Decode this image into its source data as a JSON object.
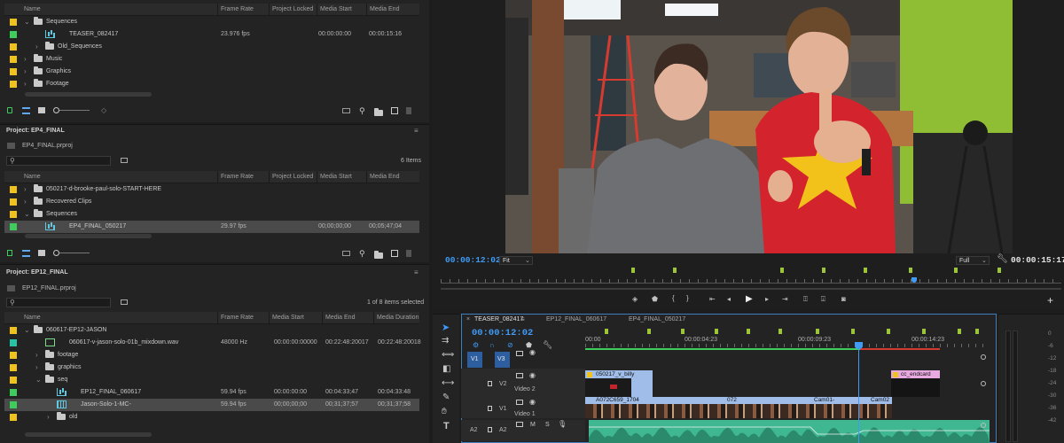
{
  "top_project": {
    "columns": [
      "Name",
      "Frame Rate",
      "Project Locked",
      "Media Start",
      "Media End"
    ],
    "rows": [
      {
        "name": "Sequences",
        "type": "folder",
        "expanded": true,
        "indent": 0,
        "color": "#f0c21e",
        "frame_rate": "",
        "locked": "",
        "media_start": "",
        "media_end": ""
      },
      {
        "name": "TEASER_082417",
        "type": "sequence",
        "indent": 2,
        "color": "#3ecc5d",
        "frame_rate": "23.976 fps",
        "locked": "",
        "media_start": "00:00:00:00",
        "media_end": "00:00:15:16"
      },
      {
        "name": "Old_Sequences",
        "type": "folder",
        "expanded": false,
        "indent": 1,
        "color": "#f0c21e",
        "frame_rate": "",
        "locked": "",
        "media_start": "",
        "media_end": ""
      },
      {
        "name": "Music",
        "type": "folder",
        "expanded": false,
        "indent": 0,
        "color": "#f0c21e",
        "frame_rate": "",
        "locked": "",
        "media_start": "",
        "media_end": ""
      },
      {
        "name": "Graphics",
        "type": "folder",
        "expanded": false,
        "indent": 0,
        "color": "#f0c21e",
        "frame_rate": "",
        "locked": "",
        "media_start": "",
        "media_end": ""
      },
      {
        "name": "Footage",
        "type": "folder",
        "expanded": false,
        "indent": 0,
        "color": "#f0c21e",
        "frame_rate": "",
        "locked": "",
        "media_start": "",
        "media_end": ""
      }
    ]
  },
  "ep4": {
    "title": "Project: EP4_FINAL",
    "file": "EP4_FINAL.prproj",
    "items_count": "6 Items",
    "columns": [
      "Name",
      "Frame Rate",
      "Project Locked",
      "Media Start",
      "Media End"
    ],
    "rows": [
      {
        "name": "050217-d-brooke-paul-solo-START-HERE",
        "type": "folder",
        "expanded": false,
        "indent": 0,
        "color": "#f0c21e",
        "frame_rate": "",
        "locked": "",
        "media_start": "",
        "media_end": ""
      },
      {
        "name": "Recovered Clips",
        "type": "folder",
        "expanded": false,
        "indent": 0,
        "color": "#f0c21e",
        "frame_rate": "",
        "locked": "",
        "media_start": "",
        "media_end": ""
      },
      {
        "name": "Sequences",
        "type": "folder",
        "expanded": true,
        "indent": 0,
        "color": "#f0c21e",
        "frame_rate": "",
        "locked": "",
        "media_start": "",
        "media_end": ""
      },
      {
        "name": "EP4_FINAL_050217",
        "type": "sequence",
        "indent": 2,
        "color": "#3ecc5d",
        "selected": true,
        "frame_rate": "29.97 fps",
        "locked": "",
        "media_start": "00;00;00;00",
        "media_end": "00;05;47;04"
      }
    ]
  },
  "ep12": {
    "title": "Project: EP12_FINAL",
    "file": "EP12_FINAL.prproj",
    "items_count": "1 of 8 items selected",
    "columns": [
      "Name",
      "Frame Rate",
      "Media Start",
      "Media End",
      "Media Duration"
    ],
    "rows": [
      {
        "name": "060617-EP12-JASON",
        "type": "folder",
        "expanded": true,
        "indent": 0,
        "color": "#f0c21e",
        "frame_rate": "",
        "media_start": "",
        "media_end": "",
        "media_duration": ""
      },
      {
        "name": "060617-v-jason-solo-01b_mixdown.wav",
        "type": "audio",
        "indent": 2,
        "color": "#26c4a4",
        "frame_rate": "48000 Hz",
        "media_start": "00:00:00:00000",
        "media_end": "00:22:48:20017",
        "media_duration": "00:22:48:20018"
      },
      {
        "name": "footage",
        "type": "folder",
        "expanded": false,
        "indent": 1,
        "color": "#f0c21e",
        "frame_rate": "",
        "media_start": "",
        "media_end": "",
        "media_duration": ""
      },
      {
        "name": "graphics",
        "type": "folder",
        "expanded": false,
        "indent": 1,
        "color": "#f0c21e",
        "frame_rate": "",
        "media_start": "",
        "media_end": "",
        "media_duration": ""
      },
      {
        "name": "seq",
        "type": "folder",
        "expanded": true,
        "indent": 1,
        "color": "#f0c21e",
        "frame_rate": "",
        "media_start": "",
        "media_end": "",
        "media_duration": ""
      },
      {
        "name": "EP12_FINAL_060617",
        "type": "sequence",
        "indent": 3,
        "color": "#3ecc5d",
        "frame_rate": "59.94 fps",
        "media_start": "00:00:00:00",
        "media_end": "00:04:33;47",
        "media_duration": "00:04:33:48"
      },
      {
        "name": "Jason-Solo-1-MC-",
        "type": "multicam",
        "indent": 3,
        "color": "#3ecc5d",
        "selected": true,
        "frame_rate": "59.94 fps",
        "media_start": "00;00;00;00",
        "media_end": "00;31;37;57",
        "media_duration": "00;31;37;58"
      },
      {
        "name": "old",
        "type": "folder",
        "expanded": false,
        "indent": 2,
        "color": "#f0c21e",
        "frame_rate": "",
        "media_start": "",
        "media_end": "",
        "media_duration": ""
      }
    ]
  },
  "program": {
    "current_tc": "00:00:12:02",
    "fit": "Fit",
    "full": "Full",
    "duration_tc": "00:00:15:17",
    "playhead_fraction": 0.7
  },
  "timeline": {
    "tabs": [
      "TEASER_082417",
      "EP12_FINAL_060617",
      "EP4_FINAL_050217"
    ],
    "tc": "00:00:12:02",
    "ruler": [
      "00:00",
      "00:00:04:23",
      "00:00:09:23",
      "00:00:14:23"
    ],
    "tracks": {
      "v1_src": "V1",
      "v3": "V3",
      "v2": "V2",
      "v2_name": "Video 2",
      "v1": "V1",
      "v1_name": "Video 1",
      "a2_src": "A2",
      "a2": "A2",
      "m": "M",
      "s": "S"
    },
    "clips": {
      "v2_a": "050217_v_billy",
      "v2_b": "cc_endcard",
      "v1_a": "A072C659_1704",
      "v1_b": "072",
      "v1_c": "Cam01-",
      "v1_d": "Cam02"
    }
  },
  "meter": {
    "scale": [
      "0",
      "-6",
      "-12",
      "-18",
      "-24",
      "-30",
      "-36",
      "-42"
    ]
  },
  "colors": {
    "accent_blue": "#3f9bf6",
    "folder": "#f0c21e",
    "sequence": "#3ecc5d",
    "audio": "#26c4a4",
    "marker": "#9dc53a"
  }
}
